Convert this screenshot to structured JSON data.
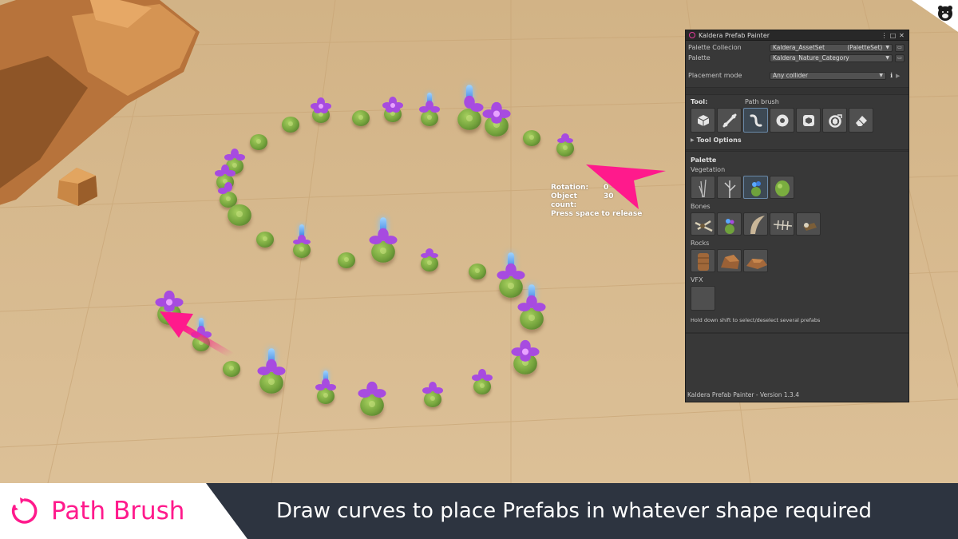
{
  "panel": {
    "window_title": "Kaldera Prefab Painter",
    "palette_collection_label": "Palette Collecion",
    "palette_collection_value": "Kaldera_AssetSet",
    "palette_collection_type": "(PaletteSet)",
    "palette_label": "Palette",
    "palette_value": "Kaldera_Nature_Category",
    "placement_mode_label": "Placement mode",
    "placement_mode_value": "Any collider",
    "tool_label": "Tool:",
    "tool_name": "Path brush",
    "tool_options_label": "Tool Options",
    "palette_section": "Palette",
    "categories": [
      "Vegetation",
      "Bones",
      "Rocks",
      "VFX"
    ],
    "hint": "Hold down shift to select/deselect several prefabs",
    "version": "Kaldera Prefab Painter - Version 1.3.4"
  },
  "overlay": {
    "rotation_label": "Rotation:",
    "rotation_value": "0",
    "count_label": "Object count:",
    "count_value": "30",
    "release_hint": "Press space to release"
  },
  "banner": {
    "title": "Path Brush",
    "tagline": "Draw curves to place Prefabs in whatever shape required"
  },
  "colors": {
    "accent": "#ff1a8c",
    "panel_bg": "#383838",
    "banner_bg": "#2d3440"
  },
  "icons": [
    "cube-icon",
    "line-brush-icon",
    "path-brush-icon",
    "circle-brush-icon",
    "box-icon",
    "replace-icon",
    "eraser-icon"
  ]
}
